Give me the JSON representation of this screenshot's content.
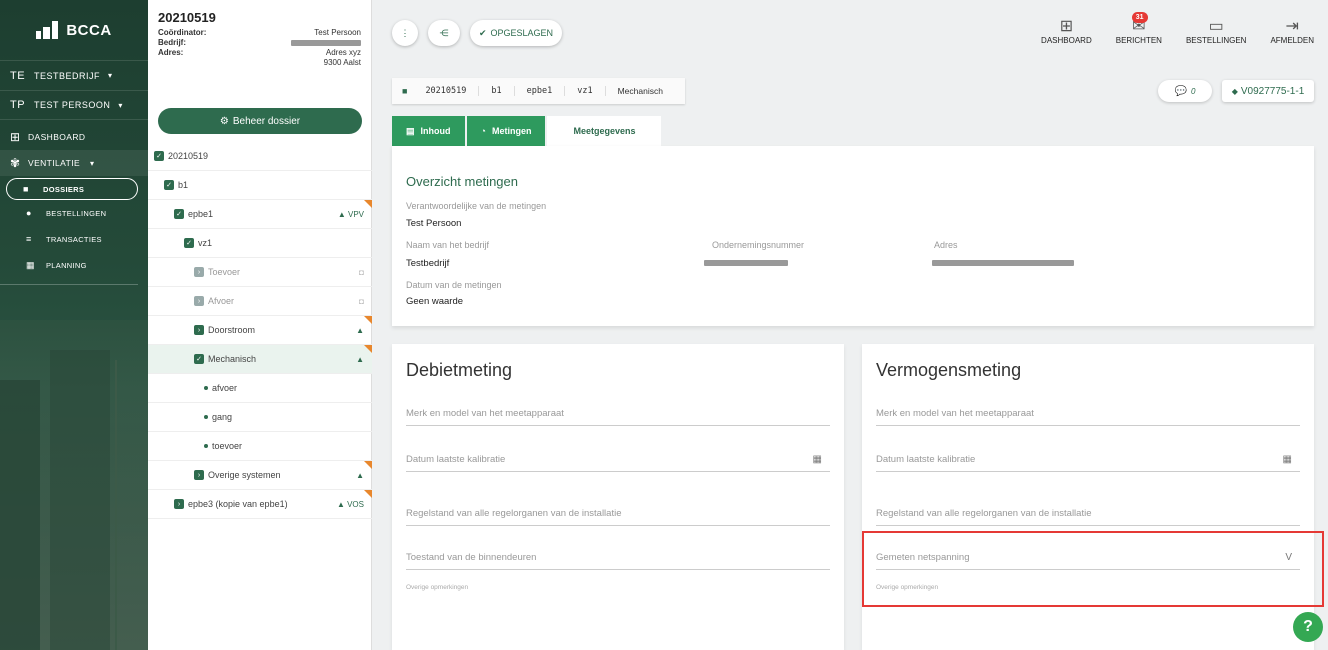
{
  "sidebar": {
    "logo": "BCCA",
    "company": {
      "initials": "TE",
      "label": "TESTBEDRIJF"
    },
    "person": {
      "initials": "TP",
      "label": "TEST PERSOON"
    },
    "nav": [
      {
        "label": "DASHBOARD",
        "icon": "grid-icon"
      },
      {
        "label": "VENTILATIE",
        "icon": "fan-icon"
      }
    ],
    "sub": [
      {
        "label": "DOSSIERS",
        "icon": "folder-icon"
      },
      {
        "label": "BESTELLINGEN",
        "icon": "cart-icon"
      },
      {
        "label": "TRANSACTIES",
        "icon": "list-icon"
      },
      {
        "label": "PLANNING",
        "icon": "calendar-icon"
      }
    ]
  },
  "tree_panel": {
    "title": "20210519",
    "coordinator_label": "Coördinator:",
    "coordinator_value": "Test Persoon",
    "bedrijf_label": "Bedrijf:",
    "adres_label": "Adres:",
    "adres_line1": "Adres xyz",
    "adres_line2": "9300 Aalst",
    "beheer_button": "Beheer dossier",
    "nodes": [
      {
        "label": "20210519"
      },
      {
        "label": "b1"
      },
      {
        "label": "epbe1",
        "right": "VPV"
      },
      {
        "label": "vz1"
      },
      {
        "label": "Toevoer"
      },
      {
        "label": "Afvoer"
      },
      {
        "label": "Doorstroom"
      },
      {
        "label": "Mechanisch"
      },
      {
        "label": "afvoer"
      },
      {
        "label": "gang"
      },
      {
        "label": "toevoer"
      },
      {
        "label": "Overige systemen"
      },
      {
        "label": "epbe3 (kopie van epbe1)",
        "right": "VOS"
      }
    ]
  },
  "header": {
    "saved_label": "OPGESLAGEN",
    "icons": [
      {
        "label": "DASHBOARD"
      },
      {
        "label": "BERICHTEN",
        "badge": "31"
      },
      {
        "label": "BESTELLINGEN"
      },
      {
        "label": "AFMELDEN"
      }
    ]
  },
  "breadcrumb": [
    "20210519",
    "b1",
    "epbe1",
    "vz1",
    "Mechanisch"
  ],
  "comment_count": "0",
  "version": "V0927775-1-1",
  "tabs": [
    "Inhoud",
    "Metingen",
    "Meetgegevens"
  ],
  "overview": {
    "title": "Overzicht metingen",
    "resp_label": "Verantwoordelijke van de metingen",
    "resp_value": "Test Persoon",
    "bedrijf_label": "Naam van het bedrijf",
    "bedrijf_value": "Testbedrijf",
    "ondernemings_label": "Ondernemingsnummer",
    "adres_label": "Adres",
    "datum_label": "Datum van de metingen",
    "datum_value": "Geen waarde"
  },
  "debiet": {
    "title": "Debietmeting",
    "f1": "Merk en model van het meetapparaat",
    "f2": "Datum laatste kalibratie",
    "f3": "Regelstand van alle regelorganen van de installatie",
    "f4": "Toestand van de binnendeuren",
    "note": "Overige opmerkingen"
  },
  "vermogen": {
    "title": "Vermogensmeting",
    "f1": "Merk en model van het meetapparaat",
    "f2": "Datum laatste kalibratie",
    "f3": "Regelstand van alle regelorganen van de installatie",
    "f4": "Gemeten netspanning",
    "f4_suffix": "V",
    "note": "Overige opmerkingen"
  },
  "help_label": "?"
}
